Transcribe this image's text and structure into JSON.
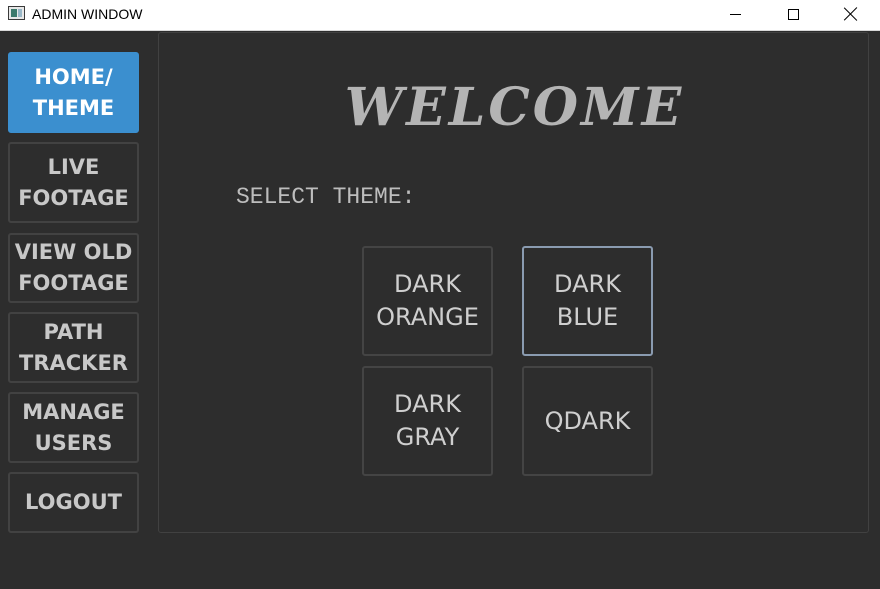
{
  "window": {
    "title": "ADMIN WINDOW"
  },
  "sidebar": {
    "items": [
      {
        "label": "HOME/\nTHEME",
        "active": true
      },
      {
        "label": "LIVE\nFOOTAGE",
        "active": false
      },
      {
        "label": "VIEW OLD\nFOOTAGE",
        "active": false
      },
      {
        "label": "PATH\nTRACKER",
        "active": false
      },
      {
        "label": "MANAGE\nUSERS",
        "active": false
      },
      {
        "label": "LOGOUT",
        "active": false
      }
    ]
  },
  "main": {
    "heading": "WELCOME",
    "select_label": "SELECT THEME:",
    "themes": [
      {
        "label": "DARK\nORANGE"
      },
      {
        "label": "DARK\nBLUE"
      },
      {
        "label": "DARK\nGRAY"
      },
      {
        "label": "QDARK"
      }
    ]
  },
  "colors": {
    "background": "#2d2d2d",
    "accent": "#3b8fcf",
    "text": "#c8c8c8",
    "focus_border": "#8a9bb0"
  }
}
